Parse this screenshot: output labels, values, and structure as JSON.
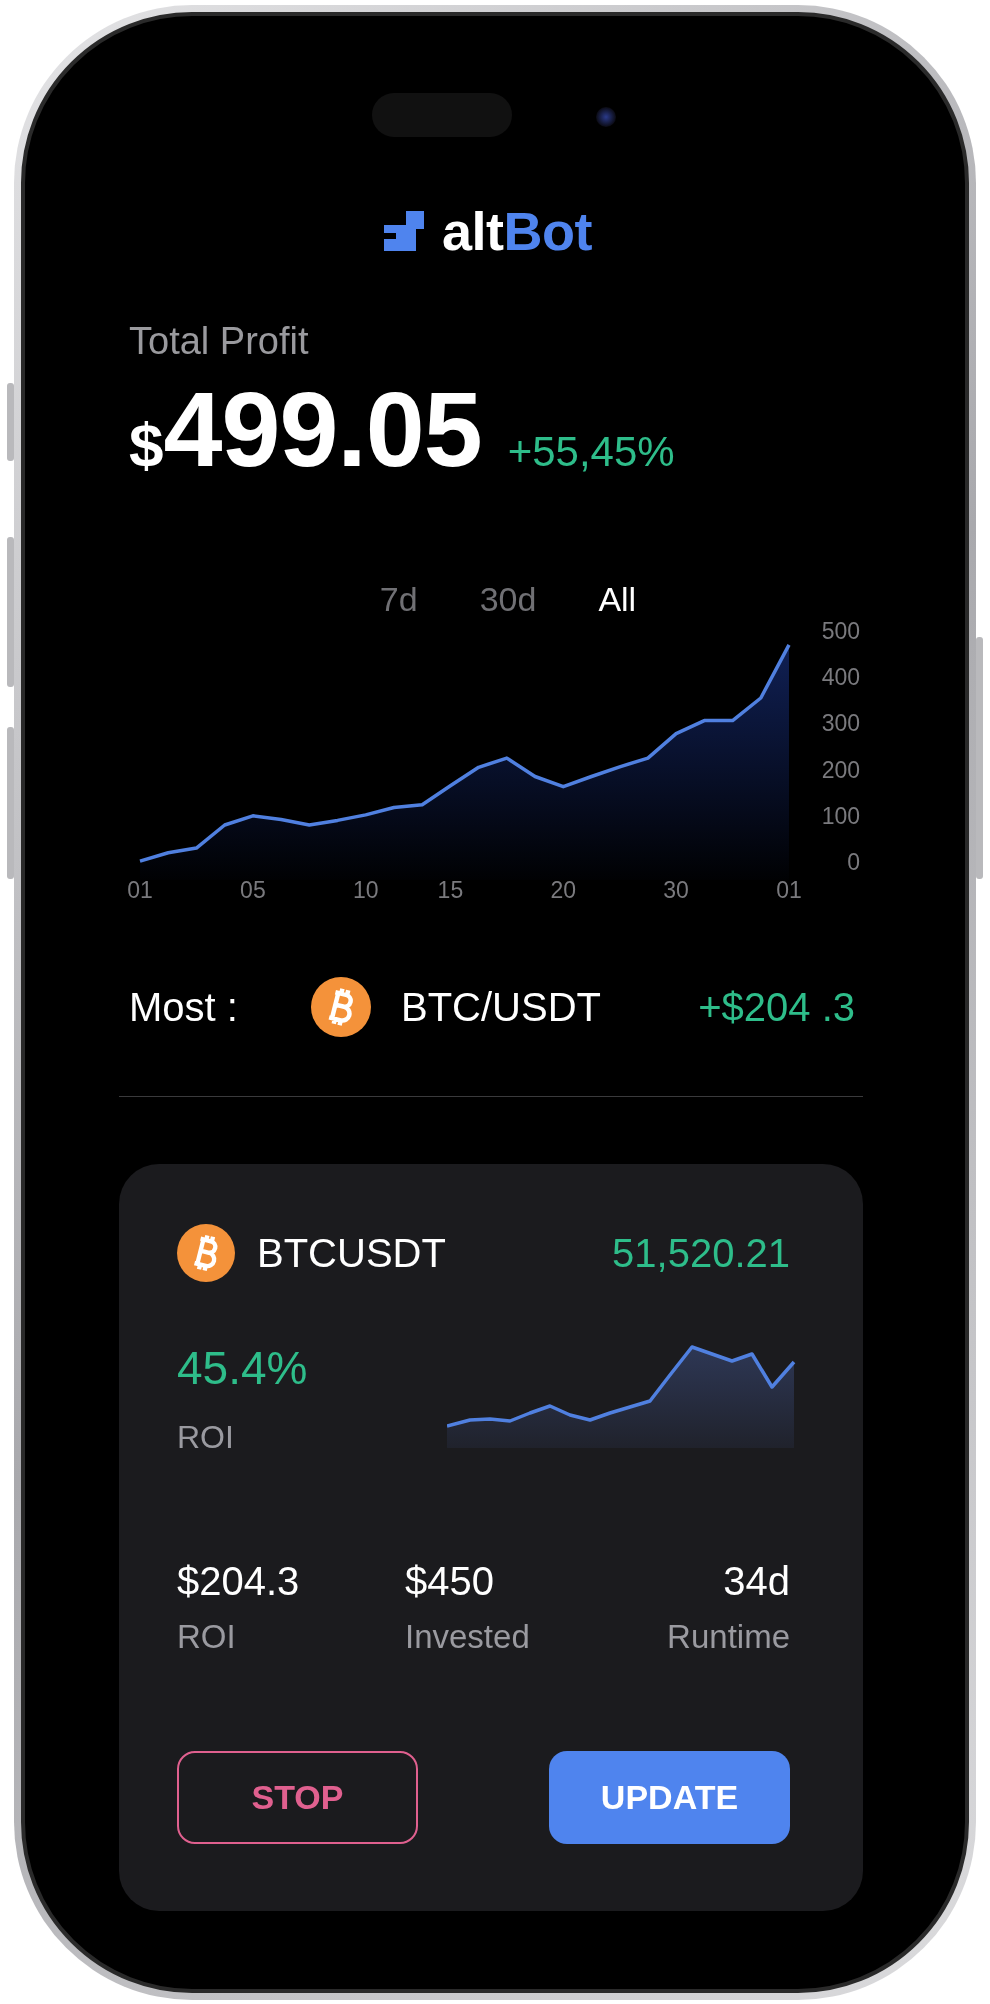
{
  "logo": {
    "parts": [
      {
        "text": "alt",
        "kind": "plain"
      },
      {
        "text": "Bot",
        "kind": "accent"
      }
    ]
  },
  "summary": {
    "label": "Total Profit",
    "currency": "$",
    "amount": "499.05",
    "change": "+55,45%"
  },
  "ranges": [
    {
      "label": "7d",
      "selected": false
    },
    {
      "label": "30d",
      "selected": false
    },
    {
      "label": "All",
      "selected": true
    }
  ],
  "chart_data": {
    "type": "area",
    "categories": [
      "01",
      null,
      null,
      null,
      "05",
      null,
      null,
      null,
      "10",
      null,
      null,
      "15",
      null,
      null,
      null,
      "20",
      null,
      null,
      null,
      "30",
      null,
      null,
      null,
      "01"
    ],
    "series": [
      {
        "color": "#5080e0",
        "values": [
          2,
          20,
          30,
          80,
          100,
          92,
          80,
          90,
          102,
          118,
          124,
          165,
          205,
          225,
          185,
          163,
          185,
          206,
          225,
          278,
          306,
          306,
          355,
          470
        ]
      }
    ],
    "ylim": [
      0,
      500
    ],
    "yticks": [
      0,
      100,
      200,
      300,
      400,
      500
    ]
  },
  "top_pair": {
    "label": "Most :",
    "pair": "BTC/USDT",
    "profit": "+$204 .3"
  },
  "bot": {
    "symbol": "BTCUSDT",
    "price": "51,520.21",
    "roi_percent": "45.4%",
    "roi_label": "ROI",
    "stats": [
      {
        "value": "$204.3",
        "label": "ROI"
      },
      {
        "value": "$450",
        "label": "Invested"
      },
      {
        "value": "34d",
        "label": "Runtime"
      }
    ],
    "buttons": [
      {
        "label": "STOP",
        "kind": "outline"
      },
      {
        "label": "UPDATE",
        "kind": "primary"
      }
    ]
  }
}
